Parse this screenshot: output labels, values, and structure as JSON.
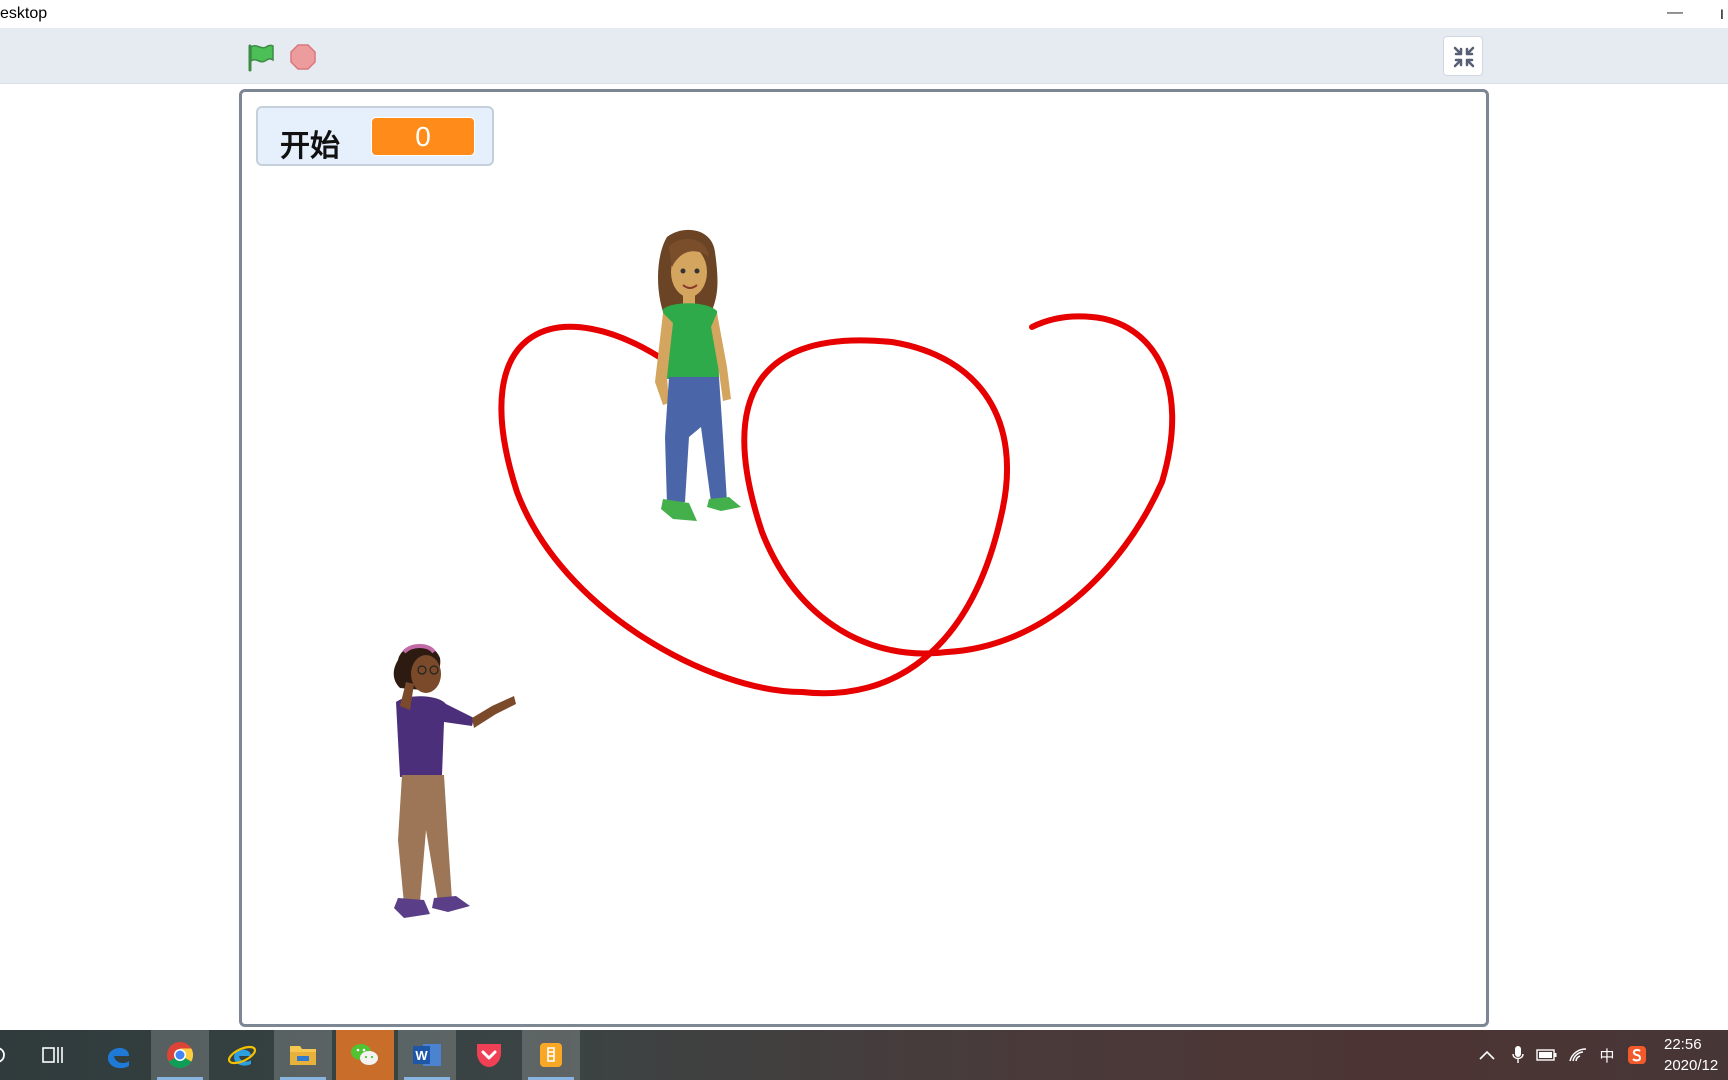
{
  "window": {
    "title": "esktop",
    "minimize_glyph": "—",
    "edge_glyph": "I"
  },
  "toolbar": {
    "green_flag_icon": "green-flag-icon",
    "stop_icon": "stop-icon",
    "fullscreen_exit_icon": "unfullscreen-icon"
  },
  "stage": {
    "variable_monitor": {
      "label": "开始",
      "value": "0"
    },
    "sprites": [
      "girl-green-shirt",
      "girl-purple-shirt"
    ],
    "pen_color": "#e60000"
  },
  "taskbar": {
    "apps": [
      {
        "name": "task-view",
        "icon": "task-view-icon"
      },
      {
        "name": "edge",
        "icon": "edge-icon"
      },
      {
        "name": "chrome",
        "icon": "chrome-icon"
      },
      {
        "name": "internet-explorer",
        "icon": "ie-icon"
      },
      {
        "name": "file-explorer",
        "icon": "folder-icon"
      },
      {
        "name": "wechat",
        "icon": "wechat-icon"
      },
      {
        "name": "word",
        "icon": "word-icon",
        "label": "W"
      },
      {
        "name": "pocket",
        "icon": "pocket-icon"
      },
      {
        "name": "scratch-desktop",
        "icon": "scratch-icon"
      }
    ],
    "tray": {
      "ime": "中",
      "clock_time": "22:56",
      "clock_date": "2020/12"
    }
  },
  "colors": {
    "toolbar_bg": "#e6ebf2",
    "monitor_value_bg": "#ff8c1a",
    "pen": "#e60000",
    "flag": "#4cbf56",
    "stop": "#ec9c9c"
  }
}
